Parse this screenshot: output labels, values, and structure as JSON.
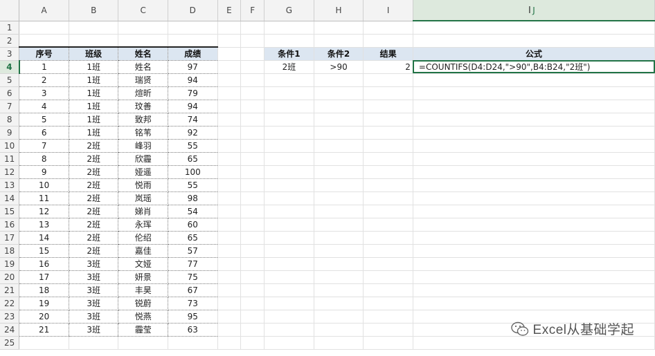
{
  "columns": [
    "A",
    "B",
    "C",
    "D",
    "E",
    "F",
    "G",
    "H",
    "I",
    "J"
  ],
  "rows": [
    "1",
    "2",
    "3",
    "4",
    "5",
    "6",
    "7",
    "8",
    "9",
    "10",
    "11",
    "12",
    "13",
    "14",
    "15",
    "16",
    "17",
    "18",
    "19",
    "20",
    "21",
    "22",
    "23",
    "24",
    "25"
  ],
  "table": {
    "headers": [
      "序号",
      "班级",
      "姓名",
      "成绩"
    ],
    "rows": [
      [
        "1",
        "1班",
        "姓名",
        "97"
      ],
      [
        "2",
        "1班",
        "瑞贤",
        "94"
      ],
      [
        "3",
        "1班",
        "煊昕",
        "79"
      ],
      [
        "4",
        "1班",
        "玟善",
        "94"
      ],
      [
        "5",
        "1班",
        "致邦",
        "74"
      ],
      [
        "6",
        "1班",
        "铭苇",
        "92"
      ],
      [
        "7",
        "2班",
        "峰羽",
        "55"
      ],
      [
        "8",
        "2班",
        "欣霾",
        "65"
      ],
      [
        "9",
        "2班",
        "娅遥",
        "100"
      ],
      [
        "10",
        "2班",
        "悦雨",
        "55"
      ],
      [
        "11",
        "2班",
        "岚瑶",
        "98"
      ],
      [
        "12",
        "2班",
        "娣肖",
        "54"
      ],
      [
        "13",
        "2班",
        "永珲",
        "60"
      ],
      [
        "14",
        "2班",
        "伦绍",
        "65"
      ],
      [
        "15",
        "2班",
        "嘉佳",
        "57"
      ],
      [
        "16",
        "3班",
        "文娅",
        "77"
      ],
      [
        "17",
        "3班",
        "妍景",
        "75"
      ],
      [
        "18",
        "3班",
        "丰昊",
        "67"
      ],
      [
        "19",
        "3班",
        "锐蔚",
        "73"
      ],
      [
        "20",
        "3班",
        "悦燕",
        "95"
      ],
      [
        "21",
        "3班",
        "霾莹",
        "63"
      ]
    ]
  },
  "criteria": {
    "headers": [
      "条件1",
      "条件2",
      "结果",
      "公式"
    ],
    "cond1": "2班",
    "cond2": ">90",
    "result": "2",
    "formula": "=COUNTIFS(D4:D24,\">90\",B4:B24,\"2班\")"
  },
  "active_cell": {
    "column": "J",
    "row": "4"
  },
  "watermark": {
    "text": "Excel从基础学起",
    "icon": "wechat-icon"
  },
  "colors": {
    "header_fill": "#dce6f1",
    "selection": "#217346"
  }
}
